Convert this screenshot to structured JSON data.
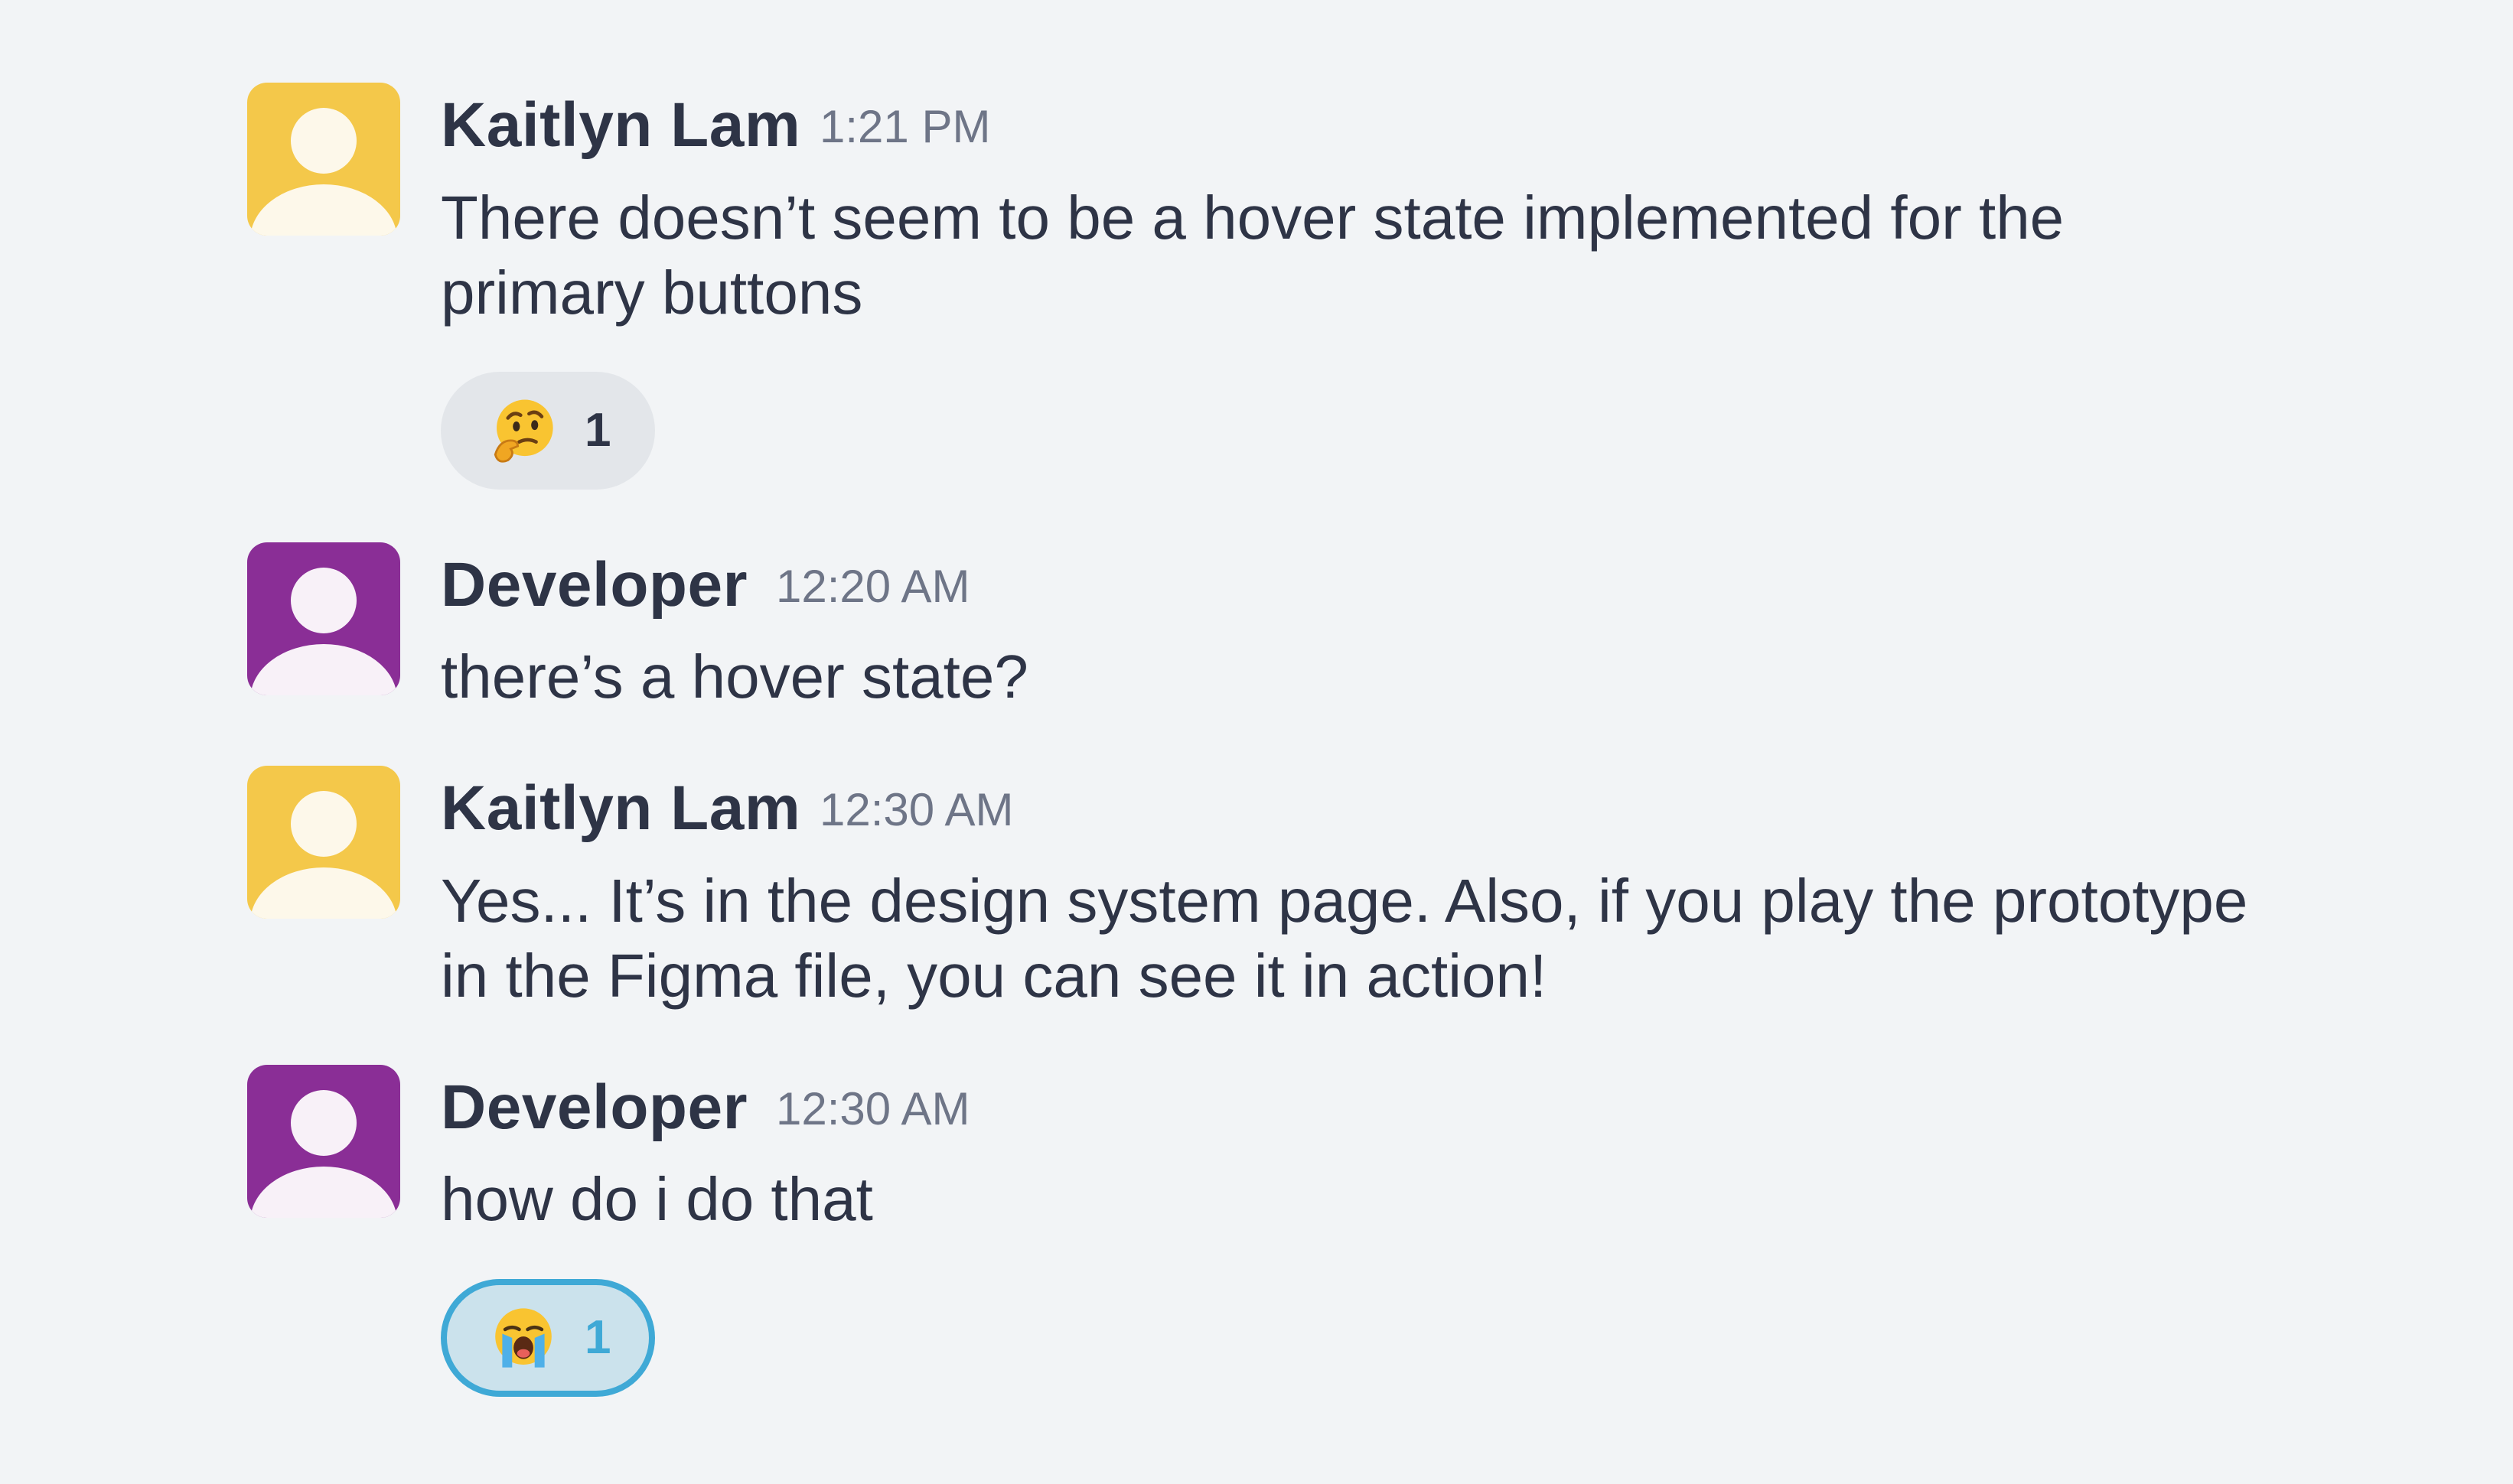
{
  "colors": {
    "background": "#f2f4f6",
    "avatar_yellow": "#f4c84a",
    "avatar_purple": "#8a2e96",
    "text": "#2e3446",
    "timestamp": "#6e7587",
    "reaction_bg": "#e3e6ea",
    "reaction_active_bg": "#cbe2ec",
    "reaction_active_border": "#3fa9d6"
  },
  "messages": [
    {
      "author": "Kaitlyn Lam",
      "time": "1:21 PM",
      "text_lines": [
        "There doesn’t seem to be a hover state implemented for the",
        "primary buttons"
      ],
      "avatar_color": "yellow",
      "reaction": {
        "emoji": "thinking-face-icon",
        "count": "1",
        "active": false
      }
    },
    {
      "author": "Developer",
      "time": "12:20 AM",
      "text_lines": [
        "there’s a hover state?"
      ],
      "avatar_color": "purple"
    },
    {
      "author": "Kaitlyn Lam",
      "time": "12:30 AM",
      "text_lines": [
        "Yes... It’s in the design system page. Also, if you play the prototype",
        "in the Figma file, you can see it in action!"
      ],
      "avatar_color": "yellow"
    },
    {
      "author": "Developer",
      "time": "12:30 AM",
      "text_lines": [
        "how do i do that"
      ],
      "avatar_color": "purple",
      "reaction": {
        "emoji": "loudly-crying-face-icon",
        "count": "1",
        "active": true
      }
    }
  ]
}
